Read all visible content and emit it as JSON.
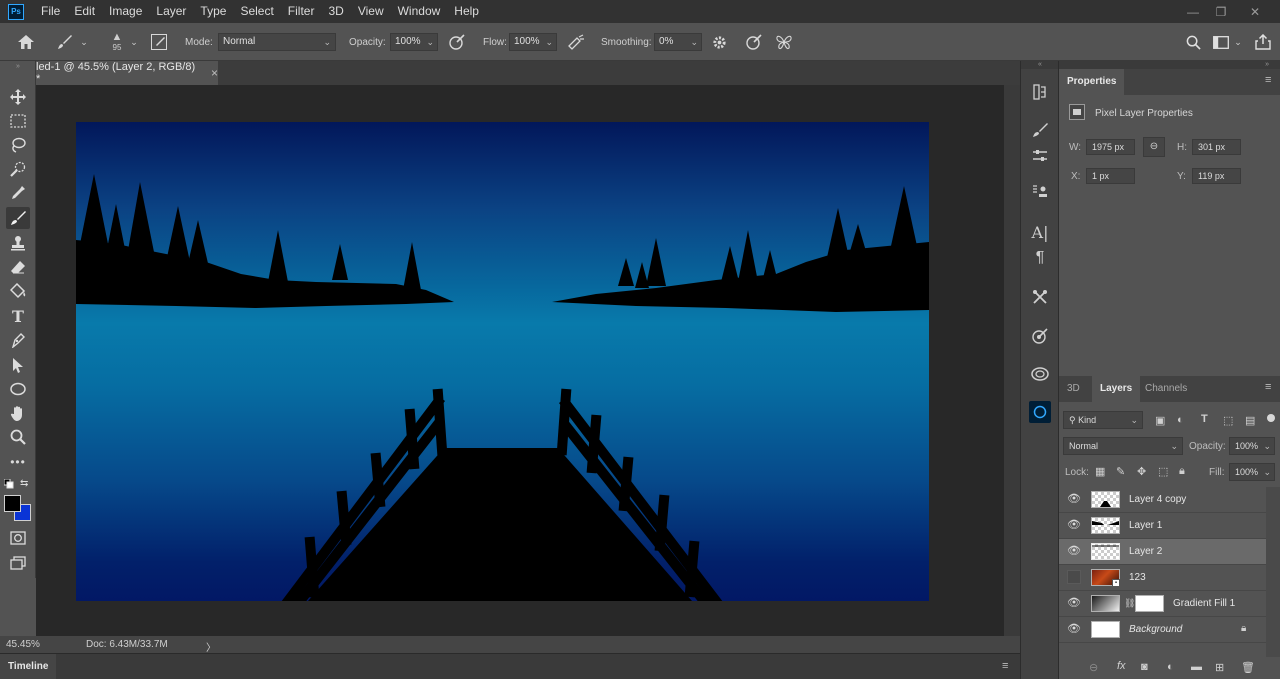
{
  "app": {
    "logo": "Ps"
  },
  "menu": [
    "File",
    "Edit",
    "Image",
    "Layer",
    "Type",
    "Select",
    "Filter",
    "3D",
    "View",
    "Window",
    "Help"
  ],
  "window_controls": {
    "minimize": "—",
    "restore": "❐",
    "close": "✕"
  },
  "options": {
    "brush_size": "95",
    "mode_label": "Mode:",
    "mode_value": "Normal",
    "opacity_label": "Opacity:",
    "opacity_value": "100%",
    "flow_label": "Flow:",
    "flow_value": "100%",
    "smoothing_label": "Smoothing:",
    "smoothing_value": "0%"
  },
  "document": {
    "tab_title": "led-1 @ 45.5% (Layer 2, RGB/8) *",
    "tab_close": "×"
  },
  "status": {
    "zoom": "45.45%",
    "doc": "Doc: 6.43M/33.7M",
    "arrow": "〉"
  },
  "timeline": {
    "label": "Timeline"
  },
  "properties": {
    "tab": "Properties",
    "section": "Pixel Layer Properties",
    "w_label": "W:",
    "w_value": "1975 px",
    "h_label": "H:",
    "h_value": "301 px",
    "x_label": "X:",
    "x_value": "1 px",
    "y_label": "Y:",
    "y_value": "119 px"
  },
  "layers_panel": {
    "tabs": [
      "3D",
      "Layers",
      "Channels"
    ],
    "filter_value": "Kind",
    "blend_mode": "Normal",
    "opacity_label": "Opacity:",
    "opacity_value": "100%",
    "lock_label": "Lock:",
    "fill_label": "Fill:",
    "fill_value": "100%",
    "layers": [
      {
        "name": "Layer 4 copy",
        "visible": true
      },
      {
        "name": "Layer 1",
        "visible": true
      },
      {
        "name": "Layer 2",
        "visible": true,
        "selected": true
      },
      {
        "name": "123",
        "visible": false
      },
      {
        "name": "Gradient Fill 1",
        "visible": true
      },
      {
        "name": "Background",
        "visible": true,
        "locked": true
      }
    ]
  },
  "colors": {
    "accent": "#31a8ff",
    "foreground": "#000000",
    "background": "#0a34d6"
  }
}
